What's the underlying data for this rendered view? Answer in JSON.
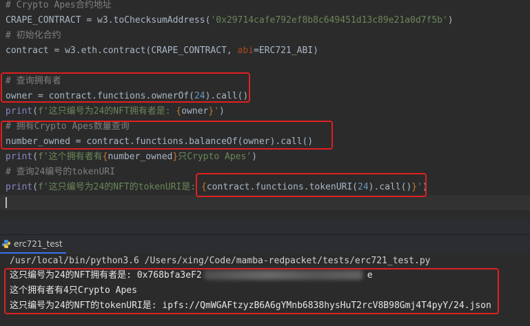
{
  "editor": {
    "lines": {
      "l0": "# Crypto Apes合约地址",
      "l1_a": "CRAPE_CONTRACT = w3.toChecksumAddress(",
      "l1_b": "'0x29714cafe792ef8b8c649451d13c89e21a0d7f5b'",
      "l1_c": ")",
      "l2": "# 初始化合约",
      "l3_a": "contract = w3.eth.contract(CRAPE_CONTRACT, ",
      "l3_b": "abi",
      "l3_c": "=ERC721_ABI)",
      "l4": "# 查询拥有者",
      "l5_a": "owner = contract.functions.ownerOf(",
      "l5_b": "24",
      "l5_c": ").call()",
      "l6_a": "print",
      "l6_b": "(",
      "l6_c": "f'这只编号为24的NFT拥有者是: ",
      "l6_d": "{",
      "l6_e": "owner",
      "l6_f": "}",
      "l6_g": "'",
      "l6_h": ")",
      "l7": "# 拥有Crypto Apes数量查询",
      "l8": "number_owned = contract.functions.balanceOf(owner).call()",
      "l9_a": "print",
      "l9_b": "(",
      "l9_c": "f'这个拥有者有",
      "l9_d": "{",
      "l9_e": "number_owned",
      "l9_f": "}",
      "l9_g": "只Crypto Apes'",
      "l9_h": ")",
      "l10": "# 查询24编号的tokenURI",
      "l11_a": "print",
      "l11_b": "(",
      "l11_c": "f'这只编号为24的NFT的tokenURI是: ",
      "l11_d": "{",
      "l11_e": "contract.functions.tokenURI(",
      "l11_f": "24",
      "l11_g": ").call()",
      "l11_h": "}",
      "l11_i": "'",
      "l11_j": ")"
    }
  },
  "run_panel": {
    "tab_label": "erc721_test",
    "icon": "python-file-icon"
  },
  "console": {
    "command": "/usr/local/bin/python3.6 /Users/xing/Code/mamba-redpacket/tests/erc721_test.py",
    "out1": "这只编号为24的NFT拥有者是: 0x768bfa3eF2",
    "out1_tail": "e",
    "out2": "这个拥有者有4只Crypto Apes",
    "out3": "这只编号为24的NFT的tokenURI是: ipfs://QmWGAFtzyzB6A6gYMnb6838hysHuT2rcV8B98Gmj4T4pyY/24.json"
  },
  "colors": {
    "highlight_box": "#e02020",
    "comment": "#808080",
    "string": "#6a8759",
    "number": "#6897bb",
    "builtin": "#8888c6"
  }
}
